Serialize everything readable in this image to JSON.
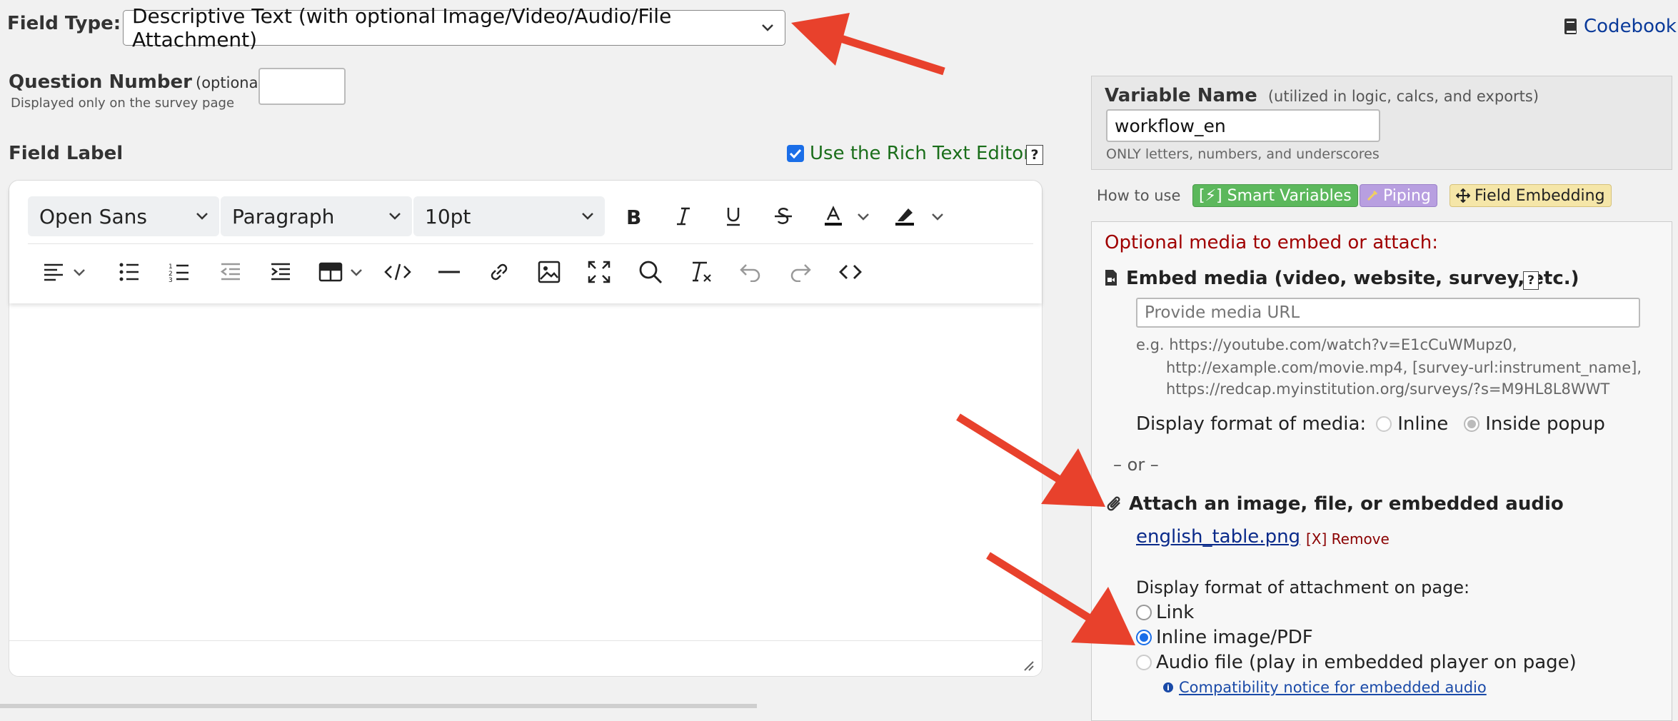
{
  "field_type": {
    "label": "Field Type:",
    "value": "Descriptive Text (with optional Image/Video/Audio/File Attachment)"
  },
  "codebook": {
    "label": "Codebook"
  },
  "question_number": {
    "label": "Question Number",
    "optional": "(optional)",
    "hint": "Displayed only on the survey page",
    "value": ""
  },
  "field_label": {
    "label": "Field Label",
    "rich_text_label": "Use the Rich Text Editor",
    "rich_text_checked": true,
    "help": "?"
  },
  "editor": {
    "font_family": "Open Sans",
    "block_format": "Paragraph",
    "font_size": "10pt",
    "content": ""
  },
  "variable": {
    "label": "Variable Name",
    "note": "(utilized in logic, calcs, and exports)",
    "value": "workflow_en",
    "hint": "ONLY letters, numbers, and underscores"
  },
  "how_to_use": {
    "label": "How to use",
    "smart_variables": "[⚡] Smart Variables",
    "piping": "Piping",
    "field_embedding": "Field Embedding"
  },
  "media": {
    "heading": "Optional media to embed or attach:",
    "embed_title": "Embed media (video, website, survey, etc.)",
    "help": "?",
    "url_placeholder": "Provide media URL",
    "examples_line1": "e.g. https://youtube.com/watch?v=E1cCuWMupz0,",
    "examples_line2": "http://example.com/movie.mp4, [survey-url:instrument_name],",
    "examples_line3": "https://redcap.myinstitution.org/surveys/?s=M9HL8L8WWT",
    "display_label": "Display format of media:",
    "inline": "Inline",
    "popup": "Inside popup",
    "or": "– or –",
    "attach_title": "Attach an image, file, or embedded audio",
    "file_name": "english_table.png",
    "remove": "[X] Remove",
    "attach_display_label": "Display format of attachment on page:",
    "opt_link": "Link",
    "opt_inline": "Inline image/PDF",
    "opt_audio": "Audio file (play in embedded player on page)",
    "compat_notice": "Compatibility notice for embedded audio"
  },
  "colors": {
    "arrow": "#e8412c",
    "smart_bg": "#5cb85c",
    "piping_bg": "#b89fe0",
    "embedding_bg": "#f5e6a8",
    "heading_red": "#a00000",
    "rich_text_green": "#1a6e1a"
  }
}
